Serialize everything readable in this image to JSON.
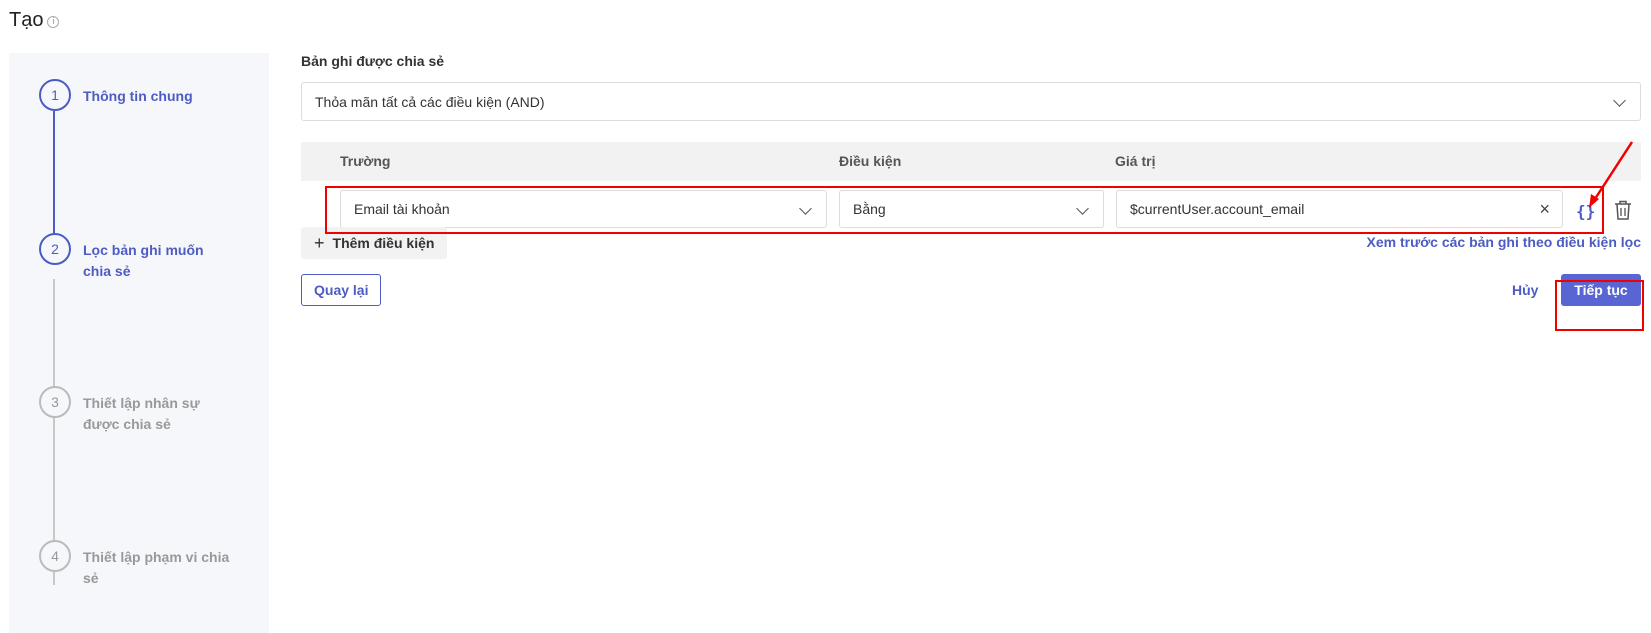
{
  "page": {
    "title": "Tạo",
    "info_icon": "ⓘ"
  },
  "stepper": {
    "steps": [
      {
        "number": "1",
        "label": "Thông tin chung",
        "state": "active"
      },
      {
        "number": "2",
        "label": "Lọc bản ghi muốn chia sẻ",
        "state": "active"
      },
      {
        "number": "3",
        "label": "Thiết lập nhân sự được chia sẻ",
        "state": "inactive"
      },
      {
        "number": "4",
        "label": "Thiết lập phạm vi chia sẻ",
        "state": "inactive"
      }
    ]
  },
  "filter": {
    "section_label": "Bản ghi được chia sẻ",
    "logic_select_value": "Thỏa mãn tất cả các điều kiện (AND)",
    "columns": {
      "field": "Trường",
      "condition": "Điều kiện",
      "value": "Giá trị"
    },
    "rows": [
      {
        "field": "Email tài khoản",
        "condition": "Bằng",
        "value": "$currentUser.account_email",
        "clear": "×",
        "brace": "{}"
      }
    ],
    "add_condition_label": "Thêm điều kiện",
    "add_plus": "+",
    "preview_link": "Xem trước các bản ghi theo điều kiện lọc"
  },
  "actions": {
    "back": "Quay lại",
    "cancel": "Hủy",
    "next": "Tiếp tục"
  },
  "colors": {
    "accent": "#4d5cc3",
    "primary_button": "#5865d3",
    "highlight": "#f20000",
    "stepper_bg": "#f6f7fb"
  }
}
